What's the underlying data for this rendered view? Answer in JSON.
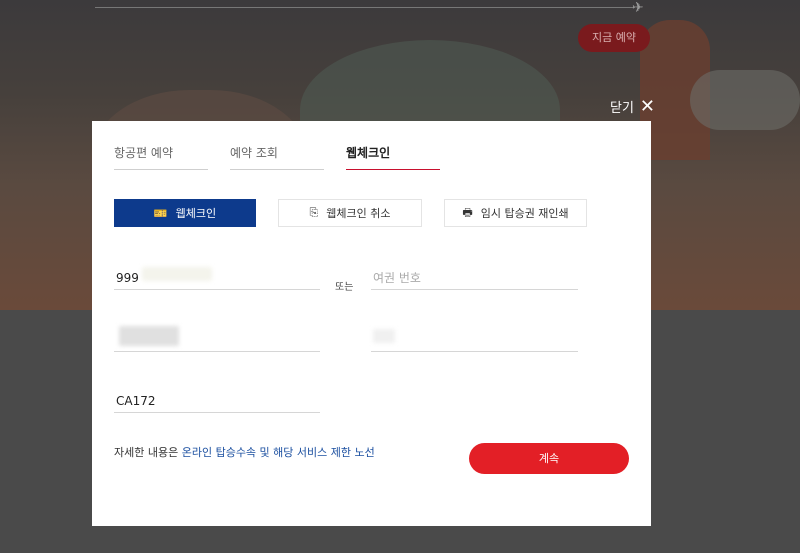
{
  "background": {
    "book_now_label": "지금 예약",
    "plane_icon": "plane-icon"
  },
  "modal": {
    "close_label": "닫기",
    "close_icon": "close-icon",
    "tabs": [
      {
        "label": "항공편 예약",
        "active": false
      },
      {
        "label": "예약 조회",
        "active": false
      },
      {
        "label": "웹체크인",
        "active": true
      }
    ],
    "modes": [
      {
        "label": "웹체크인",
        "icon": "ticket-icon",
        "active": true
      },
      {
        "label": "웹체크인 취소",
        "icon": "cancel-ticket-icon",
        "active": false
      },
      {
        "label": "임시 탑승권 재인쇄",
        "icon": "printer-icon",
        "active": false
      }
    ],
    "ticket_number_value": "999",
    "or_label": "또는",
    "passport_placeholder": "여권 번호",
    "flight_number_value": "CA172",
    "info_prefix": "자세한 내용은 ",
    "info_link": "온라인 탑승수속 및 해당 서비스 제한 노선",
    "continue_label": "계속"
  },
  "colors": {
    "accent_red": "#e31f26",
    "active_blue": "#0d3a8c",
    "link_blue": "#1b4fa0"
  }
}
